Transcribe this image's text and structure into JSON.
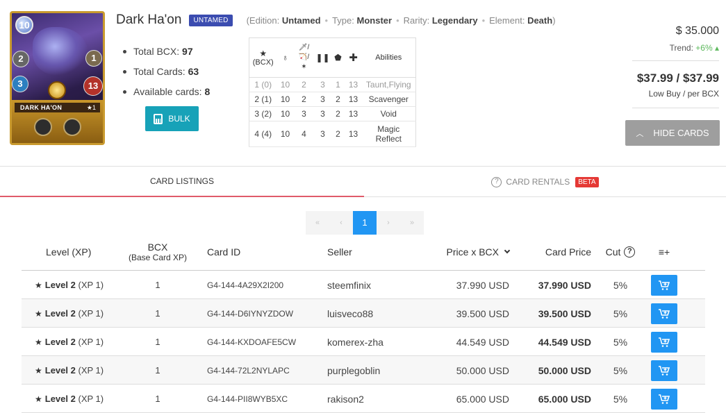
{
  "card": {
    "name": "Dark Ha'on",
    "edition_badge": "UNTAMED",
    "image_caption": "DARK HA'ON",
    "image_level": "★1",
    "mana": "10",
    "stat_left": "2",
    "stat_right": "1",
    "speed": "3",
    "health": "13"
  },
  "meta": {
    "open": "(Edition:",
    "edition": "Untamed",
    "type_label": "Type:",
    "type": "Monster",
    "rarity_label": "Rarity:",
    "rarity": "Legendary",
    "element_label": "Element:",
    "element": "Death",
    "close": ")"
  },
  "stats": {
    "total_bcx_label": "Total BCX:",
    "total_bcx": "97",
    "total_cards_label": "Total Cards:",
    "total_cards": "63",
    "available_label": "Available cards:",
    "available": "8"
  },
  "bulk_label": "BULK",
  "level_table": {
    "bcx_header": "(BCX)",
    "abilities_header": "Abilities",
    "rows": [
      {
        "lvl": "1 (0)",
        "mana": "10",
        "atk": "2",
        "spd": "3",
        "armor": "1",
        "hp": "13",
        "ability": "Taunt,Flying"
      },
      {
        "lvl": "2 (1)",
        "mana": "10",
        "atk": "2",
        "spd": "3",
        "armor": "2",
        "hp": "13",
        "ability": "Scavenger"
      },
      {
        "lvl": "3 (2)",
        "mana": "10",
        "atk": "3",
        "spd": "3",
        "armor": "2",
        "hp": "13",
        "ability": "Void"
      },
      {
        "lvl": "4 (4)",
        "mana": "10",
        "atk": "4",
        "spd": "3",
        "armor": "2",
        "hp": "13",
        "ability_l1": "Magic",
        "ability_l2": "Reflect"
      }
    ]
  },
  "pricing": {
    "price": "$ 35.000",
    "trend_label": "Trend:",
    "trend_value": "+6%",
    "low_buy": "$37.99 / $37.99",
    "low_buy_label": "Low Buy / per BCX",
    "hide_cards": "HIDE CARDS"
  },
  "tabs": {
    "listings": "CARD LISTINGS",
    "rentals": "CARD RENTALS",
    "beta": "BETA"
  },
  "pager": {
    "first": "«",
    "prev": "‹",
    "current": "1",
    "next": "›",
    "last": "»"
  },
  "listing": {
    "headers": {
      "level": "Level (XP)",
      "bcx": "BCX",
      "bcx_sub": "(Base Card XP)",
      "card_id": "Card ID",
      "seller": "Seller",
      "price_bcx": "Price x BCX",
      "card_price": "Card Price",
      "cut": "Cut",
      "add_col": "≡+"
    },
    "rows": [
      {
        "level": "Level 2",
        "xp": "(XP 1)",
        "bcx": "1",
        "id": "G4-144-4A29X2I200",
        "seller": "steemfinix",
        "price_bcx": "37.990 USD",
        "card_price": "37.990 USD",
        "cut": "5%"
      },
      {
        "level": "Level 2",
        "xp": "(XP 1)",
        "bcx": "1",
        "id": "G4-144-D6IYNYZDOW",
        "seller": "luisveco88",
        "price_bcx": "39.500 USD",
        "card_price": "39.500 USD",
        "cut": "5%"
      },
      {
        "level": "Level 2",
        "xp": "(XP 1)",
        "bcx": "1",
        "id": "G4-144-KXDOAFE5CW",
        "seller": "komerex-zha",
        "price_bcx": "44.549 USD",
        "card_price": "44.549 USD",
        "cut": "5%"
      },
      {
        "level": "Level 2",
        "xp": "(XP 1)",
        "bcx": "1",
        "id": "G4-144-72L2NYLAPC",
        "seller": "purplegoblin",
        "price_bcx": "50.000 USD",
        "card_price": "50.000 USD",
        "cut": "5%"
      },
      {
        "level": "Level 2",
        "xp": "(XP 1)",
        "bcx": "1",
        "id": "G4-144-PII8WYB5XC",
        "seller": "rakison2",
        "price_bcx": "65.000 USD",
        "card_price": "65.000 USD",
        "cut": "5%"
      }
    ]
  },
  "colors": {
    "untamed_badge": "#3b4cb0",
    "bulk": "#17a2b8",
    "buy": "#2196f3",
    "tab_underline": "#e05a6a",
    "beta": "#e53935",
    "trend_up": "#5cb85c"
  }
}
